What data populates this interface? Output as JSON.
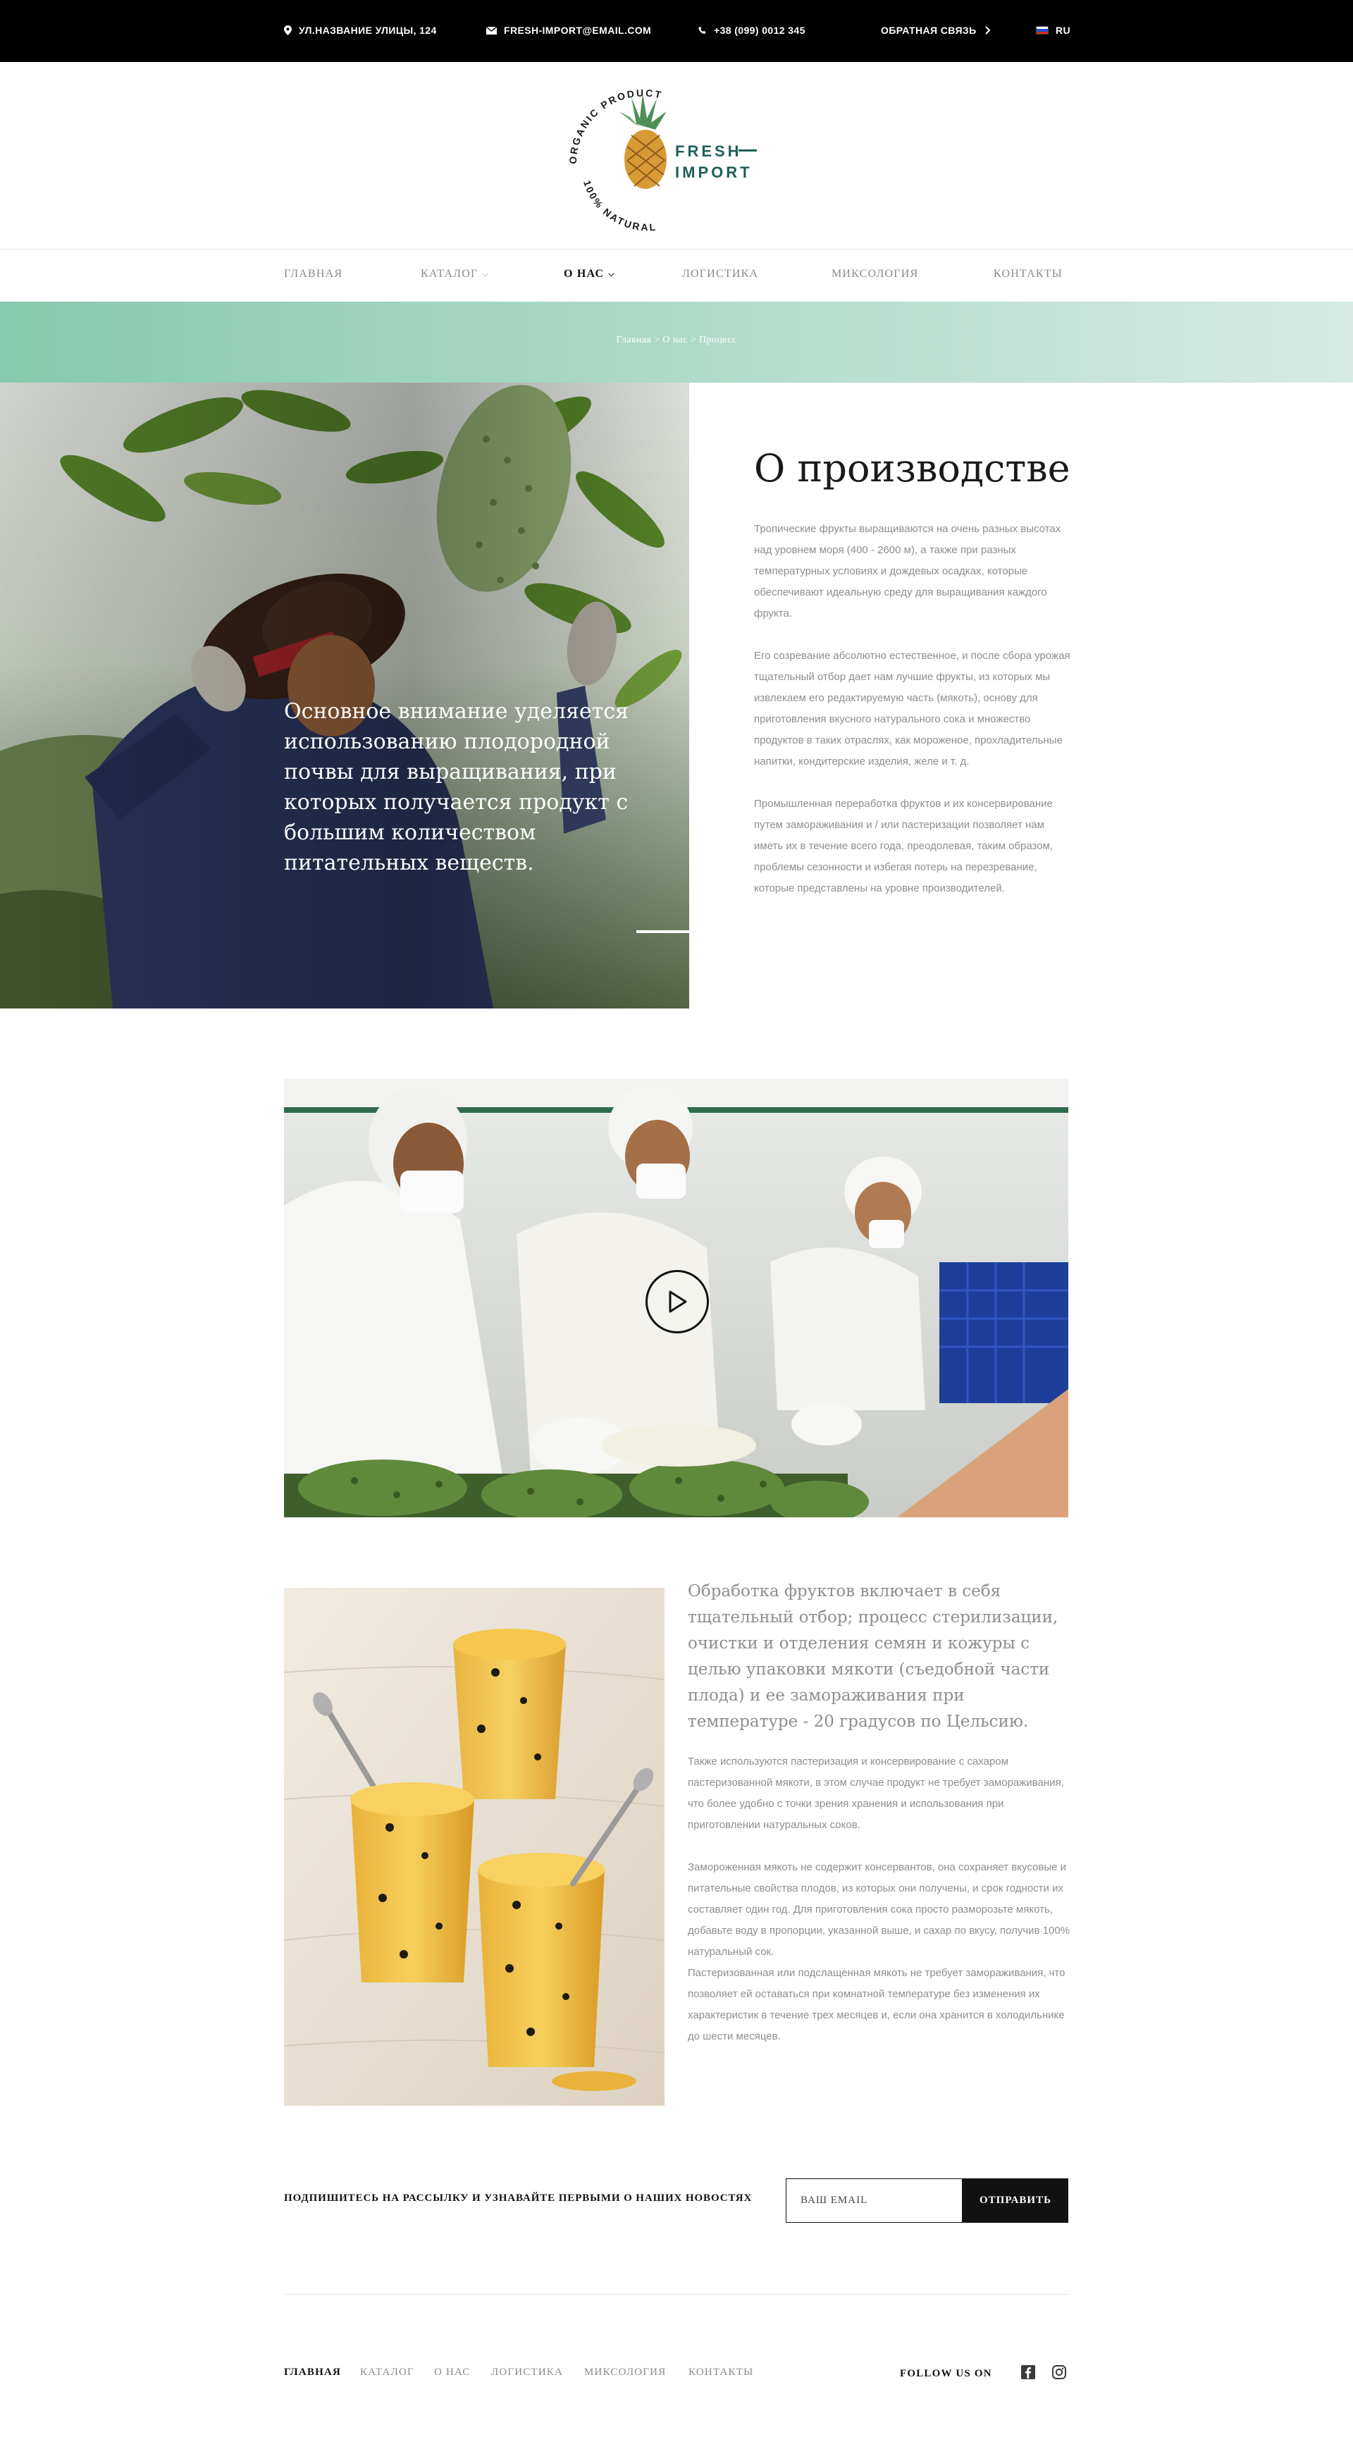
{
  "topbar": {
    "address": "УЛ.НАЗВАНИЕ УЛИЦЫ, 124",
    "email": "FRESH-IMPORT@EMAIL.COM",
    "phone": "+38 (099) 0012 345",
    "callback": "ОБРАТНАЯ СВЯЗЬ",
    "language": "RU",
    "icons": [
      "location-pin-icon",
      "mail-icon",
      "phone-icon",
      "chevron-right-icon",
      "ru-flag-icon"
    ]
  },
  "logo": {
    "ring_top": "ORGANIC PRODUCT",
    "ring_bottom": "100% NATURAL",
    "name_line1": "FRESH",
    "name_line2": "IMPORT",
    "brand_color": "#1f5f5a"
  },
  "nav": {
    "items": [
      {
        "label": "ГЛАВНАЯ"
      },
      {
        "label": "КАТАЛОГ"
      },
      {
        "label": "О НАС"
      },
      {
        "label": "ЛОГИСТИКА"
      },
      {
        "label": "МИКСОЛОГИЯ"
      },
      {
        "label": "КОНТАКТЫ"
      }
    ],
    "active": "О НАС"
  },
  "breadcrumb": {
    "text": "Главная > О нас > Процесс",
    "band_color": "#a7d6c3"
  },
  "production": {
    "quote": "Основное внимание уделяется использованию плодородной почвы для выращивания, при которых получается продукт с большим количеством питательных веществ.",
    "title": "О производстве",
    "paragraphs": [
      "Тропические фрукты выращиваются на очень разных высотах над уровнем моря (400 - 2600 м), а также при разных температурных условиях и дождевых осадках, которые обеспечивают идеальную среду для выращивания каждого фрукта.",
      "Его созревание абсолютно естественное, и после сбора урожая тщательный отбор дает нам лучшие фрукты, из которых мы извлекаем его редактируемую часть (мякоть), основу для приготовления вкусного натурального сока и множество продуктов в таких отраслях, как мороженое, прохладительные напитки, кондитерские изделия, желе и т. д.",
      "Промышленная переработка фруктов и их консервирование путем замораживания и / или пастеризации позволяет нам иметь их в течение всего года, преодолевая, таким образом, проблемы сезонности и избегая потерь на перезревание, которые представлены на уровне производителей."
    ]
  },
  "video": {
    "play_icon": "play-icon"
  },
  "processing": {
    "lead": "Обработка фруктов включает в себя тщательный отбор; процесс стерилизации, очистки и отделения семян и кожуры с целью упаковки мякоти (съедобной части плода) и ее замораживания при температуре - 20 градусов по Цельсию.",
    "paragraphs": [
      "Также используются пастеризация и консервирование с сахаром пастеризованной мякоти, в этом случае продукт не требует замораживания, что более удобно с точки зрения хранения и использования при приготовлении натуральных соков.",
      "Замороженная мякоть не содержит консервантов, она сохраняет вкусовые и питательные свойства плодов, из которых они получены, и срок годности их составляет один год. Для приготовления сока просто разморозьте мякоть, добавьте воду в пропорции, указанной выше, и сахар по вкусу, получив 100% натуральный сок.",
      "Пастеризованная или подслащенная мякоть не требует замораживания, что позволяет ей оставаться при комнатной температуре без изменения их характеристик в течение трех месяцев и, если она хранится в холодильнике до шести месяцев."
    ]
  },
  "newsletter": {
    "label": "ПОДПИШИТЕСЬ НА РАССЫЛКУ И УЗНАВАЙТЕ ПЕРВЫМИ О НАШИХ НОВОСТЯХ",
    "placeholder": "ВАШ EMAIL",
    "button": "ОТПРАВИТЬ"
  },
  "footer": {
    "nav": [
      "ГЛАВНАЯ",
      "КАТАЛОГ",
      "О НАС",
      "ЛОГИСТИКА",
      "МИКСОЛОГИЯ",
      "КОНТАКТЫ"
    ],
    "follow": "FOLLOW US ON",
    "social_icons": [
      "facebook-icon",
      "instagram-icon"
    ]
  }
}
